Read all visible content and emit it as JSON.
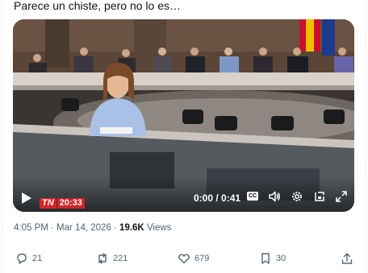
{
  "post": {
    "caption": "Parece un chiste, pero no lo es…",
    "timestamp": "4:05 PM · Mar 14, 2026",
    "views_count": "19.6K",
    "views_label": "Views"
  },
  "video": {
    "current_time": "0:00",
    "separator": "/",
    "duration": "0:41",
    "time_display": "0:00 / 0:41",
    "cc_label": "CC",
    "broadcast_logo": "TN",
    "broadcast_clock": "20:33"
  },
  "actions": {
    "replies": "21",
    "reposts": "221",
    "likes": "679",
    "bookmarks": "30"
  },
  "colors": {
    "text_primary": "#0f1419",
    "text_secondary": "#536471",
    "tn_red": "#d6232a"
  },
  "icons": [
    "play-icon",
    "captions-icon",
    "volume-icon",
    "settings-gear-icon",
    "dock-icon",
    "fullscreen-icon",
    "reply-icon",
    "repost-icon",
    "like-icon",
    "bookmark-icon",
    "share-icon"
  ]
}
